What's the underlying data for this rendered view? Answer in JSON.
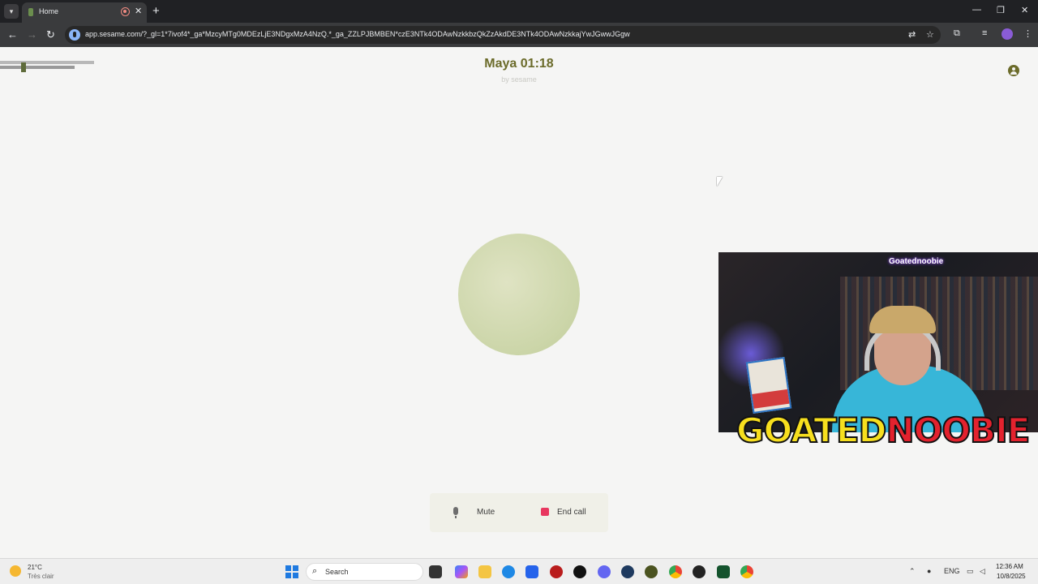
{
  "browser": {
    "tab_title": "Home",
    "new_tab_symbol": "+",
    "close_symbol": "✕",
    "url": "app.sesame.com/?_gl=1*7ivof4*_ga*MzcyMTg0MDEzLjE3NDgxMzA4NzQ.*_ga_ZZLPJBMBEN*czE3NTk4ODAwNzkkbzQkZzAkdDE3NTk4ODAwNzkkajYwJGwwJGgw",
    "back_symbol": "←",
    "forward_symbol": "→",
    "reload_symbol": "↻",
    "minimize_symbol": "—",
    "restore_symbol": "❐",
    "star_symbol": "☆"
  },
  "call": {
    "title": "Maya 01:18",
    "byline": "by sesame",
    "mute_label": "Mute",
    "end_label": "End call",
    "end_color": "#e8375f",
    "accent_color": "#6b6b2a"
  },
  "webcam": {
    "handle": "Goatednoobie",
    "brand_part1": "GOATED",
    "brand_part2": "NOOBIE"
  },
  "taskbar": {
    "weather_temp": "21°C",
    "weather_desc": "Très clair",
    "search_placeholder": "Search",
    "language": "ENG",
    "time": "12:36 AM",
    "date": "10/8/2025"
  }
}
